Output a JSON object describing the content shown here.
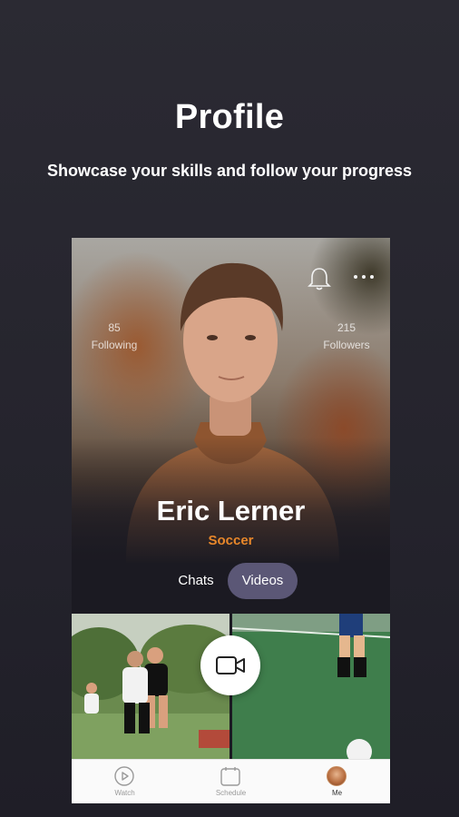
{
  "header": {
    "title": "Profile",
    "subtitle": "Showcase your skills and follow your progress"
  },
  "profile": {
    "following_count": "85",
    "following_label": "Following",
    "followers_count": "215",
    "followers_label": "Followers",
    "name": "Eric Lerner",
    "sport": "Soccer"
  },
  "tabs": [
    {
      "label": "Chats",
      "active": false
    },
    {
      "label": "Videos",
      "active": true
    }
  ],
  "icons": {
    "notifications": "bell-icon",
    "more": "more-dots-icon",
    "record": "video-camera-icon"
  },
  "bottom_nav": [
    {
      "label": "Watch",
      "icon": "play-circle-icon"
    },
    {
      "label": "Schedule",
      "icon": "calendar-icon"
    },
    {
      "label": "Me",
      "icon": "avatar"
    }
  ],
  "colors": {
    "accent": "#e8872a",
    "active_tab": "#5b5776",
    "background": "#25242d"
  }
}
